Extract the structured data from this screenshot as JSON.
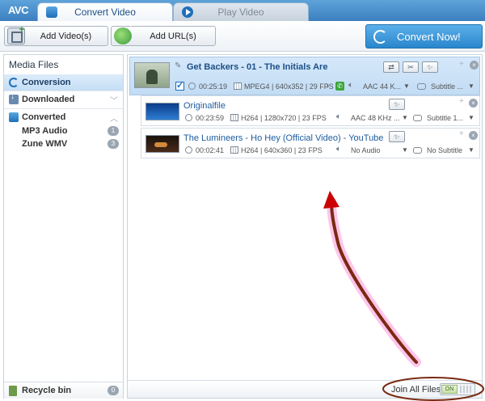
{
  "app": {
    "logo": "AVC",
    "tabs": [
      {
        "label": "Convert Video",
        "icon": "convert-video-icon",
        "active": true
      },
      {
        "label": "Play Video",
        "icon": "play-icon",
        "active": false
      }
    ]
  },
  "toolbar": {
    "add_video_label": "Add Video(s)",
    "add_url_label": "Add URL(s)",
    "convert_now_label": "Convert Now!"
  },
  "sidebar": {
    "title": "Media Files",
    "items": [
      {
        "label": "Conversion",
        "icon": "conversion-icon",
        "selected": true
      },
      {
        "label": "Downloaded",
        "icon": "download-icon"
      },
      {
        "label": "Converted",
        "icon": "converted-icon"
      }
    ],
    "converted_children": [
      {
        "label": "MP3 Audio",
        "count": "1"
      },
      {
        "label": "Zune WMV",
        "count": "3"
      }
    ],
    "recycle_bin": {
      "label": "Recycle bin",
      "count": "0"
    }
  },
  "files": {
    "main": {
      "title": "Get Backers - 01 - The Initials Are",
      "duration": "00:25:19",
      "video_info": "MPEG4 | 640x352 | 29 FPS",
      "audio": "AAC 44 K...",
      "subtitle": "Subtitle ..."
    },
    "children": [
      {
        "title": "Originalfile",
        "duration": "00:23:59",
        "video_info": "H264 | 1280x720 | 23 FPS",
        "audio": "AAC 48 KHz ...",
        "subtitle": "Subtitle 1..."
      },
      {
        "title": "The Lumineers - Ho Hey (Official Video) - YouTube",
        "duration": "00:02:41",
        "video_info": "H264 | 640x360 | 23 FPS",
        "audio": "No Audio",
        "subtitle": "No Subtitle"
      }
    ]
  },
  "statusbar": {
    "join_label": "Join All Files",
    "toggle_label": "ON"
  },
  "colors": {
    "accent": "#2a86cc",
    "selected_row": "#c2dcf4",
    "annotation_arrow": "#7a2a12",
    "annotation_head": "#cc0000",
    "annotation_glow": "#ff7fd0"
  }
}
